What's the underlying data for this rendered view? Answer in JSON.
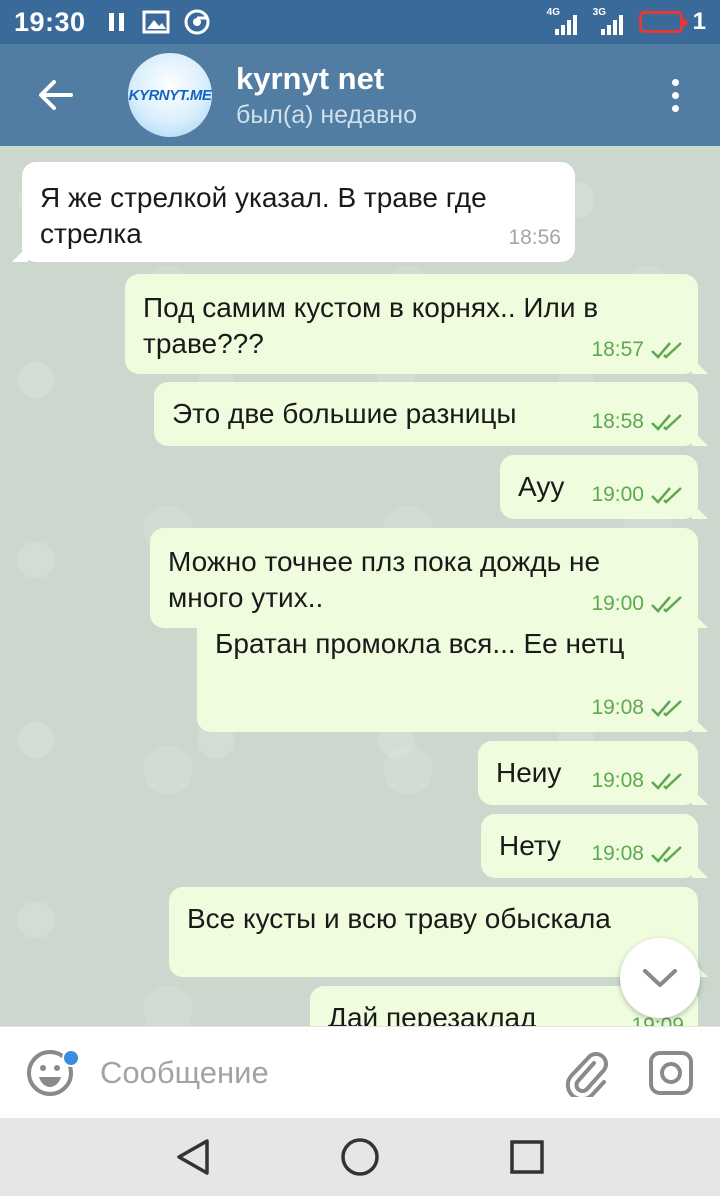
{
  "status_bar": {
    "time": "19:30",
    "network1": "4G",
    "network2": "3G",
    "battery_level": "1",
    "battery_color": "#e53935"
  },
  "header": {
    "back_icon": "arrow-left-icon",
    "avatar_text": "KYRNYT.ME",
    "title": "kyrnyt net",
    "subtitle": "был(а) недавно",
    "menu_icon": "more-vertical-icon"
  },
  "messages": [
    {
      "direction": "in",
      "text": "Я же стрелкой указал. В траве где стрелка",
      "time": "18:56"
    },
    {
      "direction": "out",
      "text": "Под самим кустом в корнях.. Или в траве???",
      "time": "18:57",
      "read": true
    },
    {
      "direction": "out",
      "text": "Это две большие разницы",
      "time": "18:58",
      "read": true
    },
    {
      "direction": "out",
      "text": "Ауу",
      "time": "19:00",
      "read": true
    },
    {
      "direction": "out",
      "text": "Можно точнее плз пока дождь не много утих..",
      "time": "19:00",
      "read": true
    },
    {
      "direction": "out",
      "text": "Братан промокла вся... Ее нетц",
      "time": "19:08",
      "read": true
    },
    {
      "direction": "out",
      "text": "Неиу",
      "time": "19:08",
      "read": true
    },
    {
      "direction": "out",
      "text": "Нету",
      "time": "19:08",
      "read": true
    },
    {
      "direction": "out",
      "text": "Все кусты и всю траву обыскала",
      "time": "19:",
      "read": true
    },
    {
      "direction": "out",
      "text": "Дай перезаклад",
      "time": "19:09",
      "read": true
    }
  ],
  "composer": {
    "placeholder": "Сообщение",
    "emoji_icon": "emoji-icon",
    "attach_icon": "paperclip-icon",
    "camera_icon": "camera-icon"
  },
  "colors": {
    "status_bar": "#3a6a99",
    "app_bar": "#527da3",
    "incoming_bubble": "#ffffff",
    "outgoing_bubble": "#effdde",
    "read_check": "#5fa852",
    "chat_background": "#ccd8cd"
  }
}
